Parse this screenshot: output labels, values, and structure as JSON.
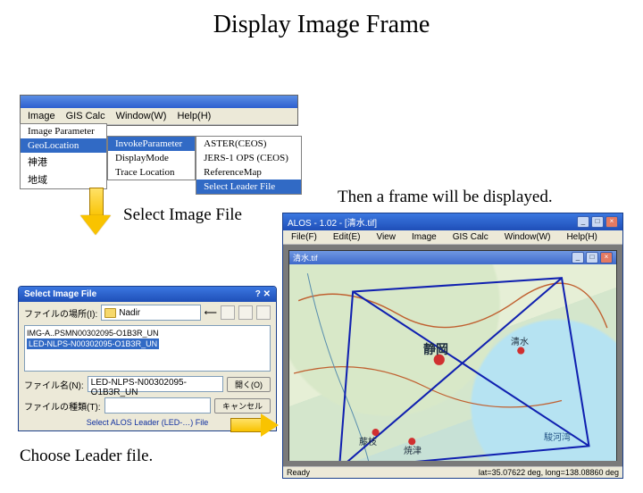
{
  "title": "Display Image Frame",
  "labels": {
    "select_image_file": "Select Image File",
    "then_frame": "Then a frame will be displayed.",
    "choose_leader": "Choose Leader file."
  },
  "menu": {
    "items": [
      "Image",
      "GIS Calc",
      "Window(W)",
      "Help(H)"
    ],
    "sub1": {
      "items": [
        "Image Parameter",
        "GeoLocation",
        "神港",
        "地域"
      ],
      "highlighted": "GeoLocation"
    },
    "sub2": {
      "items": [
        "InvokeParameter",
        "DisplayMode",
        "Trace Location"
      ],
      "highlighted": "InvokeParameter"
    },
    "sub3": {
      "items": [
        "ASTER(CEOS)",
        "JERS-1 OPS (CEOS)",
        "ReferenceMap",
        "Select Leader File"
      ],
      "highlighted": "Select Leader File"
    }
  },
  "dialog": {
    "title": "Select Image File",
    "look_in_label": "ファイルの場所(I):",
    "look_in_value": "Nadir",
    "files": [
      "IMG-A..PSMN00302095-O1B3R_UN",
      "LED-NLPS-N00302095-O1B3R_UN"
    ],
    "filename_label": "ファイル名(N):",
    "filename_value": "LED-NLPS-N00302095-O1B3R_UN",
    "filetype_label": "ファイルの種類(T):",
    "filetype_value": "",
    "open_btn": "開く(O)",
    "cancel_btn": "キャンセル",
    "hint": "Select ALOS Leader (LED-…) File"
  },
  "viewer": {
    "app_title": "ALOS - 1.02 - [清水.tif]",
    "doc_title": "清水.tif",
    "menu": [
      "File(F)",
      "Edit(E)",
      "View",
      "Image",
      "GIS Calc",
      "Window(W)",
      "Help(H)"
    ],
    "status_left": "Ready",
    "status_right": "lat=35.07622 deg, long=138.08860 deg",
    "places": {
      "shizuoka": "静岡",
      "shimizu": "清水",
      "fujieda": "藤枝",
      "yaizu": "焼津",
      "suruga_bay": "駿河湾"
    }
  }
}
